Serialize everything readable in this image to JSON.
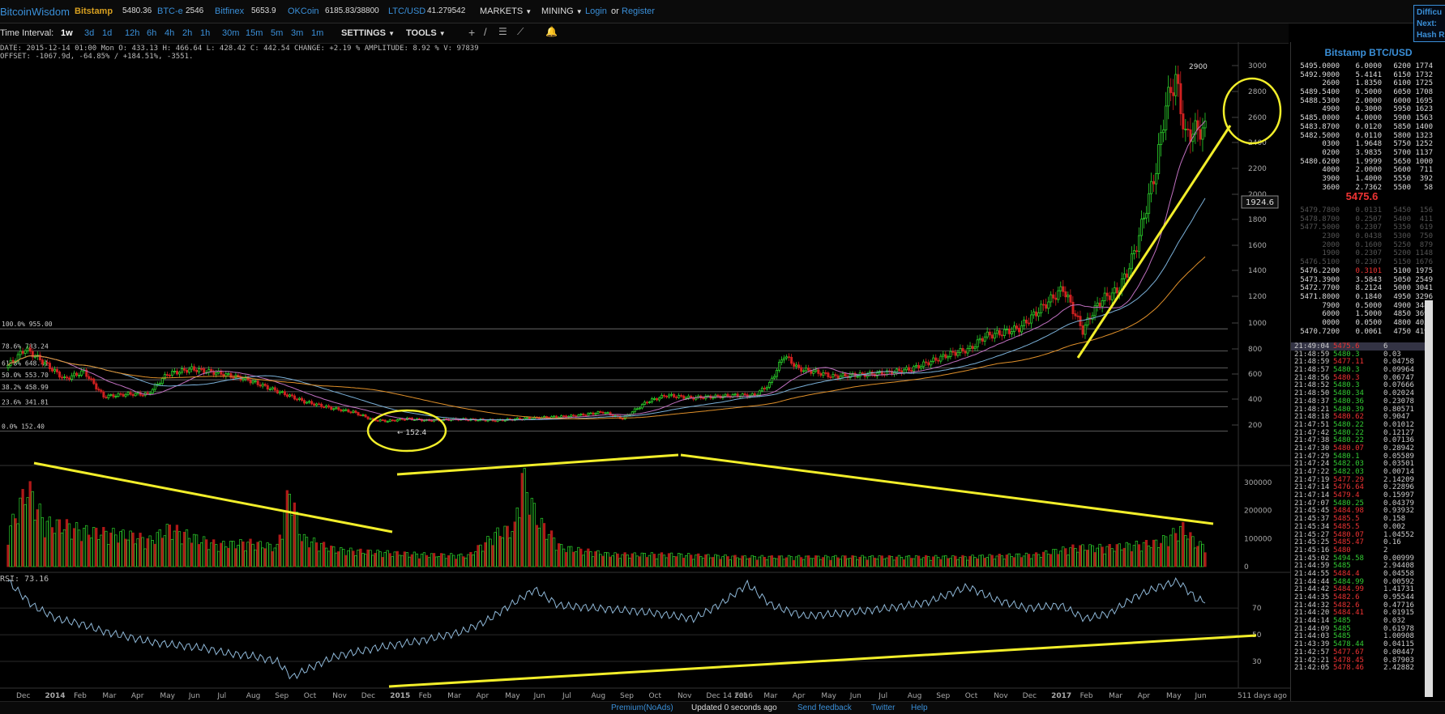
{
  "header": {
    "logo": "BitcoinWisdom",
    "exchanges": [
      {
        "name": "Bitstamp",
        "value": "5480.36"
      },
      {
        "name": "BTC-e",
        "value": "2546"
      },
      {
        "name": "Bitfinex",
        "value": "5653.9"
      },
      {
        "name": "OKCoin",
        "value": "6185.83/38800"
      },
      {
        "name": "LTC/USD",
        "value": "41.279542"
      }
    ],
    "markets_label": "MARKETS",
    "mining_label": "MINING",
    "login": "Login",
    "or": "or",
    "register": "Register",
    "difficulty": {
      "line1": "Difficu",
      "line2": "Next:",
      "line3": "Hash R"
    }
  },
  "toolbar": {
    "time_interval_label": "Time Interval:",
    "intervals": [
      "1w",
      "3d",
      "1d",
      "12h",
      "6h",
      "4h",
      "2h",
      "1h",
      "30m",
      "15m",
      "5m",
      "3m",
      "1m"
    ],
    "active_interval": "1w",
    "settings": "SETTINGS",
    "tools": "TOOLS"
  },
  "info": {
    "line1": "DATE: 2015-12-14 01:00 Mon    O: 433.13    H: 466.64    L: 428.42    C: 442.54    CHANGE: +2.19 %    AMPLITUDE: 8.92 %    V: 97839",
    "line2": "OFFSET: -1067.9d, -64.85% / +184.51%, -3551.",
    "rsi": "RSI: 73.16"
  },
  "chart_data": {
    "type": "candlestick",
    "price_axis": {
      "ticks": [
        200,
        400,
        600,
        800,
        1000,
        1200,
        1400,
        1600,
        1800,
        2000,
        2200,
        2400,
        2600,
        2800,
        3000
      ],
      "ylim": [
        100,
        3050
      ]
    },
    "volume_axis": {
      "ticks": [
        0,
        100000,
        200000,
        300000
      ],
      "labels": [
        "0",
        "100000",
        "200000",
        "300000"
      ],
      "ylim": [
        0,
        360000
      ]
    },
    "rsi_axis": {
      "ticks": [
        30,
        50,
        70
      ],
      "ylim": [
        10,
        95
      ]
    },
    "x_labels": [
      "Dec",
      "2014",
      "Feb",
      "Mar",
      "Apr",
      "May",
      "Jun",
      "Jul",
      "Aug",
      "Sep",
      "Oct",
      "Nov",
      "Dec",
      "2015",
      "Feb",
      "Mar",
      "Apr",
      "May",
      "Jun",
      "Jul",
      "Aug",
      "Sep",
      "Oct",
      "Nov",
      "Dec 14 2016",
      "Feb",
      "Mar",
      "Apr",
      "May",
      "Jun",
      "Jul",
      "Aug",
      "Sep",
      "Oct",
      "Nov",
      "Dec",
      "2017",
      "Feb",
      "Mar",
      "Apr",
      "May",
      "Jun",
      "511 days ago"
    ],
    "fib_levels": [
      {
        "label": "100.0% 955.00",
        "value": 955
      },
      {
        "label": "78.6% 783.24",
        "value": 783.24
      },
      {
        "label": "61.8% 648.41",
        "value": 648.41
      },
      {
        "label": "50.0% 553.70",
        "value": 553.7
      },
      {
        "label": "38.2% 458.99",
        "value": 458.99
      },
      {
        "label": "23.6% 341.81",
        "value": 341.81
      },
      {
        "label": "0.0% 152.40",
        "value": 152.4
      }
    ],
    "price_marker": "1924.6",
    "high_label": "2900",
    "low_label": "← 152.4",
    "price_trajectory": [
      [
        0,
        650
      ],
      [
        8,
        800
      ],
      [
        15,
        700
      ],
      [
        24,
        560
      ],
      [
        32,
        620
      ],
      [
        40,
        420
      ],
      [
        50,
        440
      ],
      [
        58,
        440
      ],
      [
        66,
        600
      ],
      [
        76,
        640
      ],
      [
        86,
        610
      ],
      [
        98,
        560
      ],
      [
        110,
        470
      ],
      [
        122,
        380
      ],
      [
        133,
        330
      ],
      [
        142,
        300
      ],
      [
        150,
        240
      ],
      [
        156,
        230
      ],
      [
        164,
        250
      ],
      [
        172,
        235
      ],
      [
        185,
        245
      ],
      [
        200,
        235
      ],
      [
        212,
        250
      ],
      [
        222,
        260
      ],
      [
        232,
        270
      ],
      [
        244,
        300
      ],
      [
        252,
        250
      ],
      [
        262,
        380
      ],
      [
        270,
        430
      ],
      [
        280,
        410
      ],
      [
        290,
        420
      ],
      [
        298,
        430
      ],
      [
        306,
        430
      ],
      [
        312,
        520
      ],
      [
        318,
        750
      ],
      [
        324,
        640
      ],
      [
        330,
        620
      ],
      [
        338,
        580
      ],
      [
        346,
        590
      ],
      [
        354,
        600
      ],
      [
        362,
        615
      ],
      [
        370,
        640
      ],
      [
        378,
        700
      ],
      [
        386,
        760
      ],
      [
        394,
        800
      ],
      [
        400,
        900
      ],
      [
        406,
        920
      ],
      [
        414,
        960
      ],
      [
        420,
        1060
      ],
      [
        426,
        1160
      ],
      [
        432,
        1260
      ],
      [
        436,
        1100
      ],
      [
        440,
        940
      ],
      [
        444,
        1080
      ],
      [
        448,
        1180
      ],
      [
        454,
        1240
      ],
      [
        458,
        1380
      ],
      [
        462,
        1600
      ],
      [
        466,
        1900
      ],
      [
        470,
        2200
      ],
      [
        474,
        2700
      ],
      [
        478,
        2900
      ],
      [
        482,
        2450
      ],
      [
        486,
        2500
      ]
    ],
    "volume_trajectory": [
      [
        0,
        140000
      ],
      [
        8,
        330000
      ],
      [
        15,
        180000
      ],
      [
        24,
        170000
      ],
      [
        30,
        150000
      ],
      [
        40,
        140000
      ],
      [
        50,
        130000
      ],
      [
        58,
        110000
      ],
      [
        66,
        160000
      ],
      [
        76,
        120000
      ],
      [
        86,
        90000
      ],
      [
        98,
        100000
      ],
      [
        110,
        80000
      ],
      [
        115,
        320000
      ],
      [
        120,
        120000
      ],
      [
        134,
        70000
      ],
      [
        150,
        60000
      ],
      [
        170,
        50000
      ],
      [
        188,
        45000
      ],
      [
        200,
        140000
      ],
      [
        207,
        160000
      ],
      [
        210,
        380000
      ],
      [
        216,
        200000
      ],
      [
        226,
        80000
      ],
      [
        246,
        50000
      ],
      [
        270,
        50000
      ],
      [
        300,
        40000
      ],
      [
        330,
        40000
      ],
      [
        360,
        40000
      ],
      [
        390,
        40000
      ],
      [
        420,
        50000
      ],
      [
        436,
        80000
      ],
      [
        450,
        80000
      ],
      [
        470,
        100000
      ],
      [
        480,
        160000
      ],
      [
        486,
        90000
      ]
    ],
    "rsi_trajectory": [
      [
        0,
        90
      ],
      [
        10,
        72
      ],
      [
        20,
        62
      ],
      [
        30,
        58
      ],
      [
        40,
        52
      ],
      [
        50,
        48
      ],
      [
        60,
        44
      ],
      [
        70,
        42
      ],
      [
        80,
        40
      ],
      [
        90,
        36
      ],
      [
        100,
        34
      ],
      [
        110,
        30
      ],
      [
        116,
        18
      ],
      [
        122,
        24
      ],
      [
        134,
        34
      ],
      [
        150,
        40
      ],
      [
        170,
        46
      ],
      [
        185,
        52
      ],
      [
        195,
        60
      ],
      [
        205,
        72
      ],
      [
        215,
        84
      ],
      [
        225,
        72
      ],
      [
        240,
        70
      ],
      [
        255,
        68
      ],
      [
        265,
        66
      ],
      [
        280,
        62
      ],
      [
        292,
        74
      ],
      [
        302,
        88
      ],
      [
        312,
        72
      ],
      [
        325,
        64
      ],
      [
        340,
        66
      ],
      [
        360,
        70
      ],
      [
        375,
        74
      ],
      [
        392,
        86
      ],
      [
        404,
        76
      ],
      [
        416,
        70
      ],
      [
        430,
        72
      ],
      [
        440,
        62
      ],
      [
        450,
        66
      ],
      [
        460,
        78
      ],
      [
        470,
        86
      ],
      [
        478,
        90
      ],
      [
        486,
        76
      ]
    ],
    "annotations": [
      "yellow trend lines on price, volume and RSI",
      "yellow circles around 2015 low and top price area"
    ]
  },
  "right_panel": {
    "title": "Bitstamp BTC/USD",
    "asks": [
      [
        "5495.0000",
        "6.0000",
        "6200",
        "1774"
      ],
      [
        "5492.9000",
        "5.4141",
        "6150",
        "1732"
      ],
      [
        "2600",
        "1.8350",
        "6100",
        "1725"
      ],
      [
        "5489.5400",
        "0.5000",
        "6050",
        "1708"
      ],
      [
        "5488.5300",
        "2.0000",
        "6000",
        "1695"
      ],
      [
        "4900",
        "0.3000",
        "5950",
        "1623"
      ],
      [
        "5485.0000",
        "4.0000",
        "5900",
        "1563"
      ],
      [
        "5483.8700",
        "0.0120",
        "5850",
        "1400"
      ],
      [
        "5482.5000",
        "0.0110",
        "5800",
        "1323"
      ],
      [
        "0300",
        "1.9648",
        "5750",
        "1252"
      ],
      [
        "0200",
        "3.9835",
        "5700",
        "1137"
      ],
      [
        "5480.6200",
        "1.9999",
        "5650",
        "1000"
      ],
      [
        "4000",
        "2.0000",
        "5600",
        "711"
      ],
      [
        "3900",
        "1.4000",
        "5550",
        "392"
      ],
      [
        "3600",
        "2.7362",
        "5500",
        "58"
      ]
    ],
    "last_price": "5475.6",
    "bids": [
      [
        "5479.7800",
        "0.0131",
        "5450",
        "156"
      ],
      [
        "5478.8700",
        "0.2507",
        "5400",
        "411"
      ],
      [
        "5477.5000",
        "0.2307",
        "5350",
        "619"
      ],
      [
        "2300",
        "0.0438",
        "5300",
        "750"
      ],
      [
        "2000",
        "0.1600",
        "5250",
        "879"
      ],
      [
        "1900",
        "0.2307",
        "5200",
        "1148"
      ],
      [
        "5476.5100",
        "0.2307",
        "5150",
        "1676"
      ],
      [
        "5476.2200",
        "0.3101",
        "5100",
        "1975"
      ],
      [
        "5473.3900",
        "3.5843",
        "5050",
        "2549"
      ],
      [
        "5472.7700",
        "8.2124",
        "5000",
        "3041"
      ],
      [
        "5471.8000",
        "0.1840",
        "4950",
        "3296"
      ],
      [
        "7900",
        "0.5000",
        "4900",
        "3481"
      ],
      [
        "6000",
        "1.5000",
        "4850",
        "3696"
      ],
      [
        "0000",
        "0.0500",
        "4800",
        "4053"
      ],
      [
        "5470.7200",
        "0.0061",
        "4750",
        "4195"
      ]
    ],
    "trades": [
      [
        "21:49:04",
        "5475.6",
        "6",
        "r"
      ],
      [
        "21:48:59",
        "5480.3",
        "0.03",
        "g"
      ],
      [
        "21:48:59",
        "5477.11",
        "0.04758",
        "r"
      ],
      [
        "21:48:57",
        "5480.3",
        "0.09964",
        "g"
      ],
      [
        "21:48:56",
        "5480.3",
        "0.06747",
        "r"
      ],
      [
        "21:48:52",
        "5480.3",
        "0.07666",
        "g"
      ],
      [
        "21:48:50",
        "5480.34",
        "0.02024",
        "g"
      ],
      [
        "21:48:37",
        "5480.36",
        "0.23078",
        "g"
      ],
      [
        "21:48:21",
        "5480.39",
        "0.80571",
        "g"
      ],
      [
        "21:48:18",
        "5480.62",
        "0.9047",
        "r"
      ],
      [
        "21:47:51",
        "5480.22",
        "0.01012",
        "g"
      ],
      [
        "21:47:42",
        "5480.22",
        "0.12127",
        "g"
      ],
      [
        "21:47:38",
        "5480.22",
        "0.07136",
        "g"
      ],
      [
        "21:47:30",
        "5480.07",
        "0.28942",
        "r"
      ],
      [
        "21:47:29",
        "5480.1",
        "0.05589",
        "g"
      ],
      [
        "21:47:24",
        "5482.03",
        "0.03501",
        "g"
      ],
      [
        "21:47:22",
        "5482.03",
        "0.00714",
        "g"
      ],
      [
        "21:47:19",
        "5477.29",
        "2.14209",
        "r"
      ],
      [
        "21:47:14",
        "5476.64",
        "0.22896",
        "r"
      ],
      [
        "21:47:14",
        "5479.4",
        "0.15997",
        "r"
      ],
      [
        "21:47:07",
        "5480.25",
        "0.04379",
        "g"
      ],
      [
        "21:45:45",
        "5484.98",
        "0.93932",
        "r"
      ],
      [
        "21:45:37",
        "5485.5",
        "0.158",
        "r"
      ],
      [
        "21:45:34",
        "5485.5",
        "0.002",
        "r"
      ],
      [
        "21:45:27",
        "5480.07",
        "1.04552",
        "r"
      ],
      [
        "21:45:25",
        "5485.47",
        "0.16",
        "r"
      ],
      [
        "21:45:16",
        "5480",
        "2",
        "r"
      ],
      [
        "21:45:02",
        "5494.58",
        "0.00999",
        "g"
      ],
      [
        "21:44:59",
        "5485",
        "2.94408",
        "g"
      ],
      [
        "21:44:55",
        "5484.4",
        "0.04558",
        "r"
      ],
      [
        "21:44:44",
        "5484.99",
        "0.00592",
        "g"
      ],
      [
        "21:44:42",
        "5484.99",
        "1.41731",
        "r"
      ],
      [
        "21:44:35",
        "5482.6",
        "0.95544",
        "r"
      ],
      [
        "21:44:32",
        "5482.6",
        "0.47716",
        "r"
      ],
      [
        "21:44:20",
        "5484.41",
        "0.01915",
        "r"
      ],
      [
        "21:44:14",
        "5485",
        "0.032",
        "g"
      ],
      [
        "21:44:09",
        "5485",
        "0.61978",
        "g"
      ],
      [
        "21:44:03",
        "5485",
        "1.00908",
        "g"
      ],
      [
        "21:43:39",
        "5478.44",
        "0.04115",
        "g"
      ],
      [
        "21:42:57",
        "5477.67",
        "0.00447",
        "r"
      ],
      [
        "21:42:21",
        "5478.45",
        "0.87903",
        "r"
      ],
      [
        "21:42:05",
        "5478.46",
        "2.42882",
        "r"
      ]
    ]
  },
  "footer": {
    "premium": "Premium(NoAds)",
    "updated": "Updated 0 seconds ago",
    "feedback": "Send feedback",
    "twitter": "Twitter",
    "help": "Help"
  }
}
